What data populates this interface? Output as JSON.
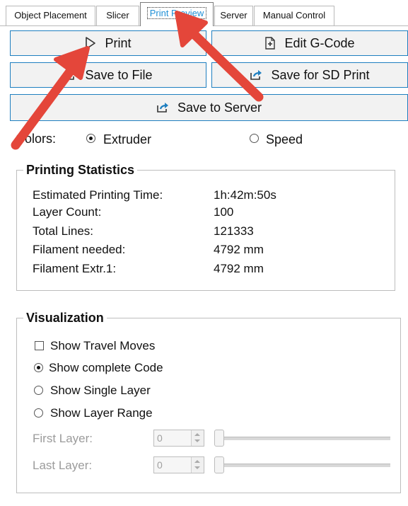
{
  "tabs": [
    {
      "label": "Object Placement",
      "active": false
    },
    {
      "label": "Slicer",
      "active": false
    },
    {
      "label": "Print Preview",
      "active": true
    },
    {
      "label": "Server",
      "active": false
    },
    {
      "label": "Manual Control",
      "active": false
    }
  ],
  "buttons": {
    "print": {
      "label": "Print",
      "icon": "play-triangle-icon"
    },
    "edit_gcode": {
      "label": "Edit G-Code",
      "icon": "edit-file-icon"
    },
    "save_to_file": {
      "label": "Save to File",
      "icon": "export-icon"
    },
    "save_sd": {
      "label": "Save for SD Print",
      "icon": "export-icon"
    },
    "save_server": {
      "label": "Save to Server",
      "icon": "export-icon"
    }
  },
  "colors": {
    "label": "Colors:",
    "options": [
      {
        "label": "Extruder",
        "selected": true
      },
      {
        "label": "Speed",
        "selected": false
      }
    ]
  },
  "statistics": {
    "title": "Printing Statistics",
    "rows": [
      {
        "label": "Estimated Printing Time:",
        "value": "1h:42m:50s"
      },
      {
        "label": "Layer Count:",
        "value": "100"
      },
      {
        "label": "Total Lines:",
        "value": "121333"
      },
      {
        "label": "Filament needed:",
        "value": "4792 mm"
      },
      {
        "label": "Filament Extr.1:",
        "value": "4792 mm"
      }
    ]
  },
  "visualization": {
    "title": "Visualization",
    "show_travel": {
      "label": "Show Travel Moves",
      "checked": false
    },
    "modes": [
      {
        "label": "Show complete Code",
        "selected": true
      },
      {
        "label": "Show Single Layer",
        "selected": false
      },
      {
        "label": "Show Layer Range",
        "selected": false
      }
    ],
    "first_layer": {
      "label": "First Layer:",
      "value": "0",
      "slider_fraction": 0
    },
    "last_layer": {
      "label": "Last Layer:",
      "value": "0",
      "slider_fraction": 0
    }
  },
  "annotation_color": "#e4463a",
  "accent_color": "#1f7fc0"
}
